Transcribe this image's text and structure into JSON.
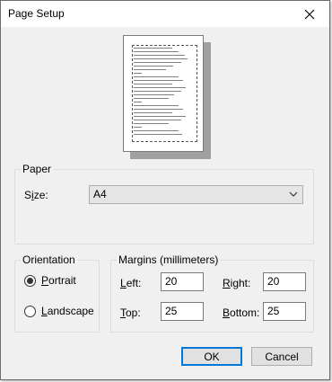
{
  "window": {
    "title": "Page Setup"
  },
  "paper": {
    "legend": "Paper",
    "size_label": "Size:",
    "size_value": "A4"
  },
  "orientation": {
    "legend": "Orientation",
    "portrait_label": "Portrait",
    "landscape_label": "Landscape",
    "selected": "Portrait"
  },
  "margins": {
    "legend": "Margins (millimeters)",
    "left_label": "Left:",
    "left_value": "20",
    "right_label": "Right:",
    "right_value": "20",
    "top_label": "Top:",
    "top_value": "25",
    "bottom_label": "Bottom:",
    "bottom_value": "25"
  },
  "buttons": {
    "ok": "OK",
    "cancel": "Cancel"
  },
  "colors": {
    "dialog_bg": "#f0f0f0",
    "default_button_border": "#0078d7"
  }
}
